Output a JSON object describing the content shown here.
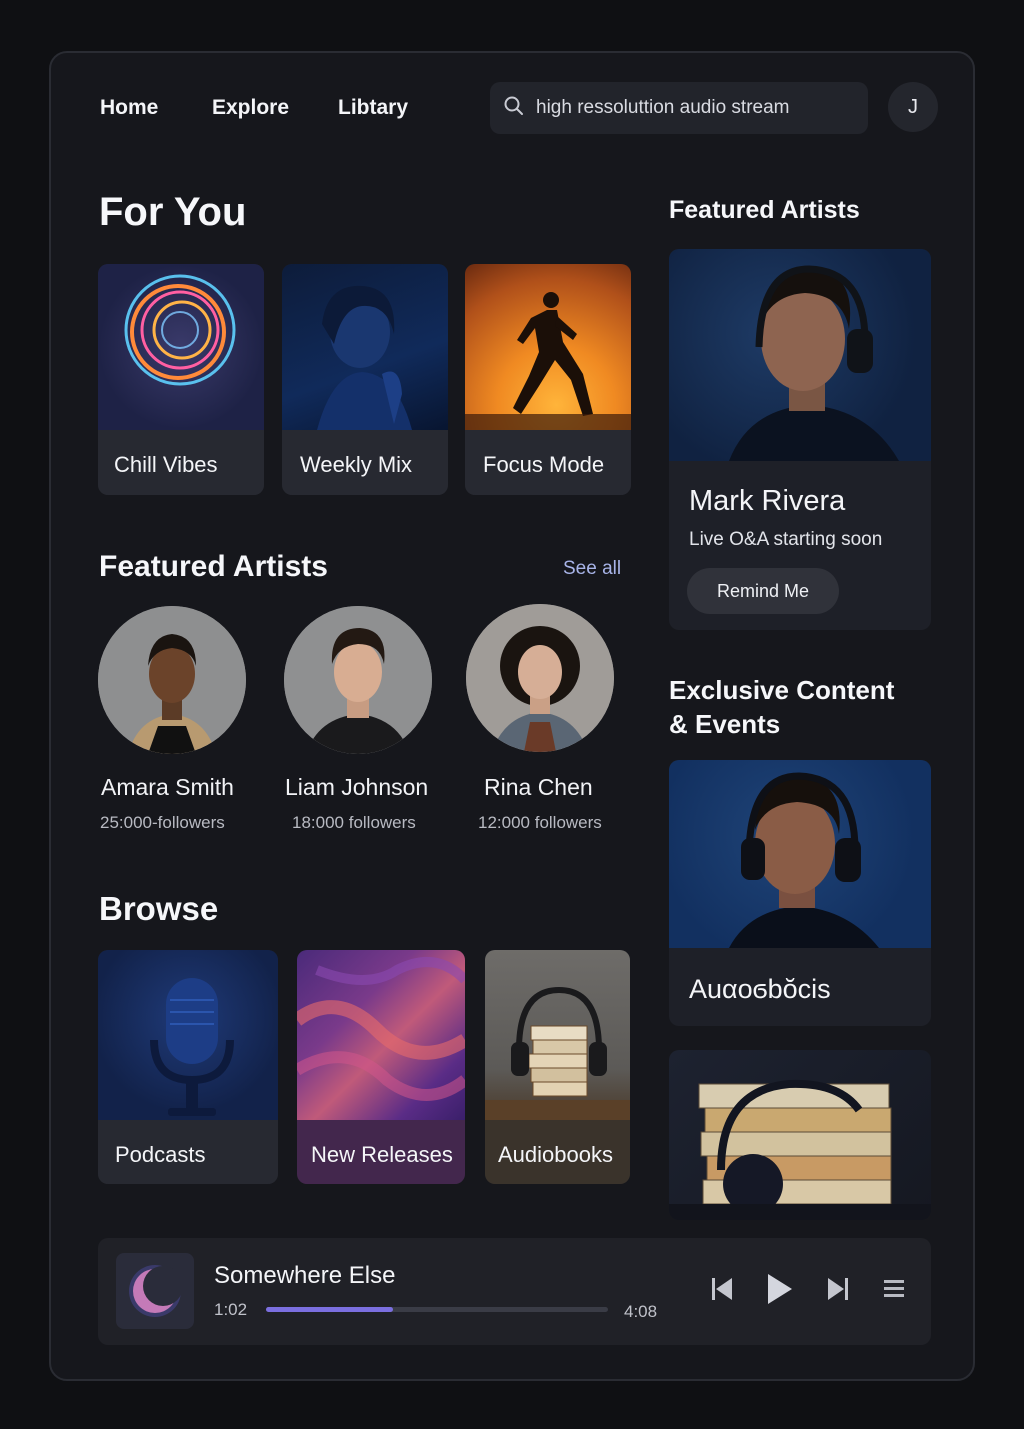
{
  "nav": {
    "home": "Home",
    "explore": "Explore",
    "library": "Libtary",
    "search_value": "high ressoluttion audio stream",
    "avatar_initial": "J"
  },
  "for_you": {
    "title": "For You",
    "cards": [
      {
        "label": "Chill Vibes",
        "icon": "neon-rings-art"
      },
      {
        "label": "Weekly Mix",
        "icon": "portrait-art"
      },
      {
        "label": "Focus Mode",
        "icon": "runner-silhouette-art"
      }
    ]
  },
  "featured_artists": {
    "title": "Featured Artists",
    "see_all": "See all",
    "artists": [
      {
        "name": "Amara Smith",
        "followers": "25:000-followers"
      },
      {
        "name": "Liam Johnson",
        "followers": "18:000 followers"
      },
      {
        "name": "Rina Chen",
        "followers": "12:000 followers"
      }
    ]
  },
  "browse": {
    "title": "Browse",
    "cards": [
      {
        "label": "Podcasts",
        "icon": "microphone-art"
      },
      {
        "label": "New Releases",
        "icon": "fluid-abstract-art"
      },
      {
        "label": "Audiobooks",
        "icon": "books-headphones-art"
      }
    ]
  },
  "sidebar": {
    "featured_title": "Featured Artists",
    "featured_name": "Mark Rivera",
    "featured_status": "Live O&A starting soon",
    "remind_label": "Remind Me",
    "exclusive_title_line1": "Exclusive Content",
    "exclusive_title_line2": "& Events",
    "exclusive_card_label": "Auαoϭbŏcis"
  },
  "player": {
    "track": "Somewhere Else",
    "elapsed": "1:02",
    "duration": "4:08",
    "progress": 0.37
  },
  "colors": {
    "accent": "#7b6fe0",
    "background": "#0f1013",
    "panel": "#16171c"
  }
}
